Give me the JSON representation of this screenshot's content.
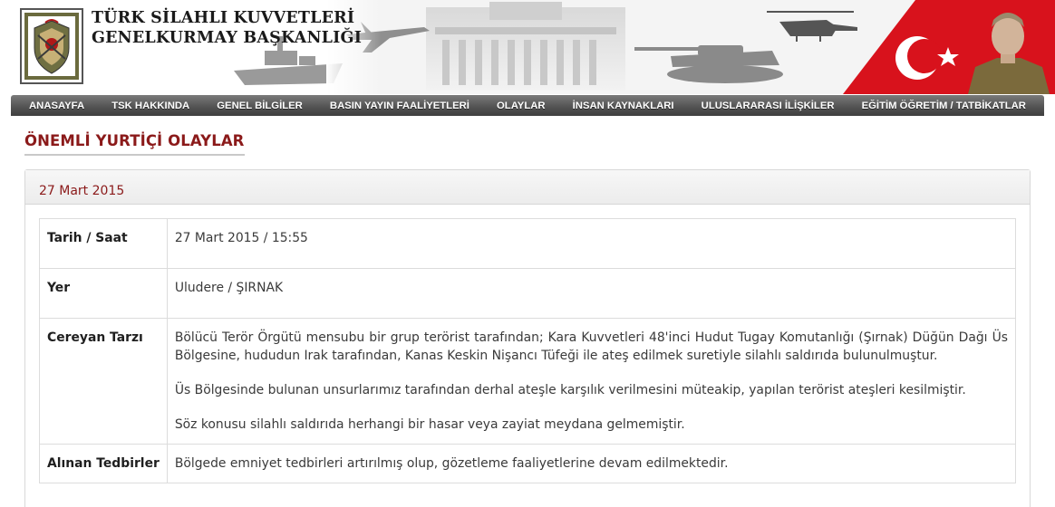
{
  "header": {
    "title_line1": "TÜRK SİLAHLI KUVVETLERİ",
    "title_line2": "GENELKURMAY BAŞKANLIĞI"
  },
  "nav": {
    "items": [
      "ANASAYFA",
      "TSK HAKKINDA",
      "GENEL BİLGİLER",
      "BASIN YAYIN FAALİYETLERİ",
      "OLAYLAR",
      "İNSAN KAYNAKLARI",
      "ULUSLARARASI İLİŞKİLER",
      "EĞİTİM ÖĞRETİM / TATBİKATLAR"
    ]
  },
  "page": {
    "title": "ÖNEMLİ YURTİÇİ OLAYLAR"
  },
  "event": {
    "date_header": "27 Mart 2015",
    "rows": [
      {
        "label": "Tarih / Saat",
        "value": "27 Mart 2015 / 15:55"
      },
      {
        "label": "Yer",
        "value": "Uludere / ŞIRNAK"
      },
      {
        "label": "Cereyan Tarzı",
        "paragraphs": [
          "Bölücü Terör Örgütü mensubu bir grup terörist tarafından; Kara Kuvvetleri 48'inci Hudut Tugay Komutanlığı (Şırnak) Düğün Dağı Üs Bölgesine, hududun Irak tarafından, Kanas Keskin Nişancı Tüfeği ile ateş edilmek suretiyle silahlı saldırıda bulunulmuştur.",
          "Üs Bölgesinde bulunan unsurlarımız tarafından derhal ateşle karşılık verilmesini müteakip, yapılan terörist ateşleri kesilmiştir.",
          "Söz konusu silahlı saldırıda herhangi bir hasar veya zayiat meydana gelmemiştir."
        ]
      },
      {
        "label": "Alınan Tedbirler",
        "value": "Bölgede emniyet tedbirleri artırılmış olup, gözetleme faaliyetlerine devam edilmektedir."
      }
    ]
  }
}
